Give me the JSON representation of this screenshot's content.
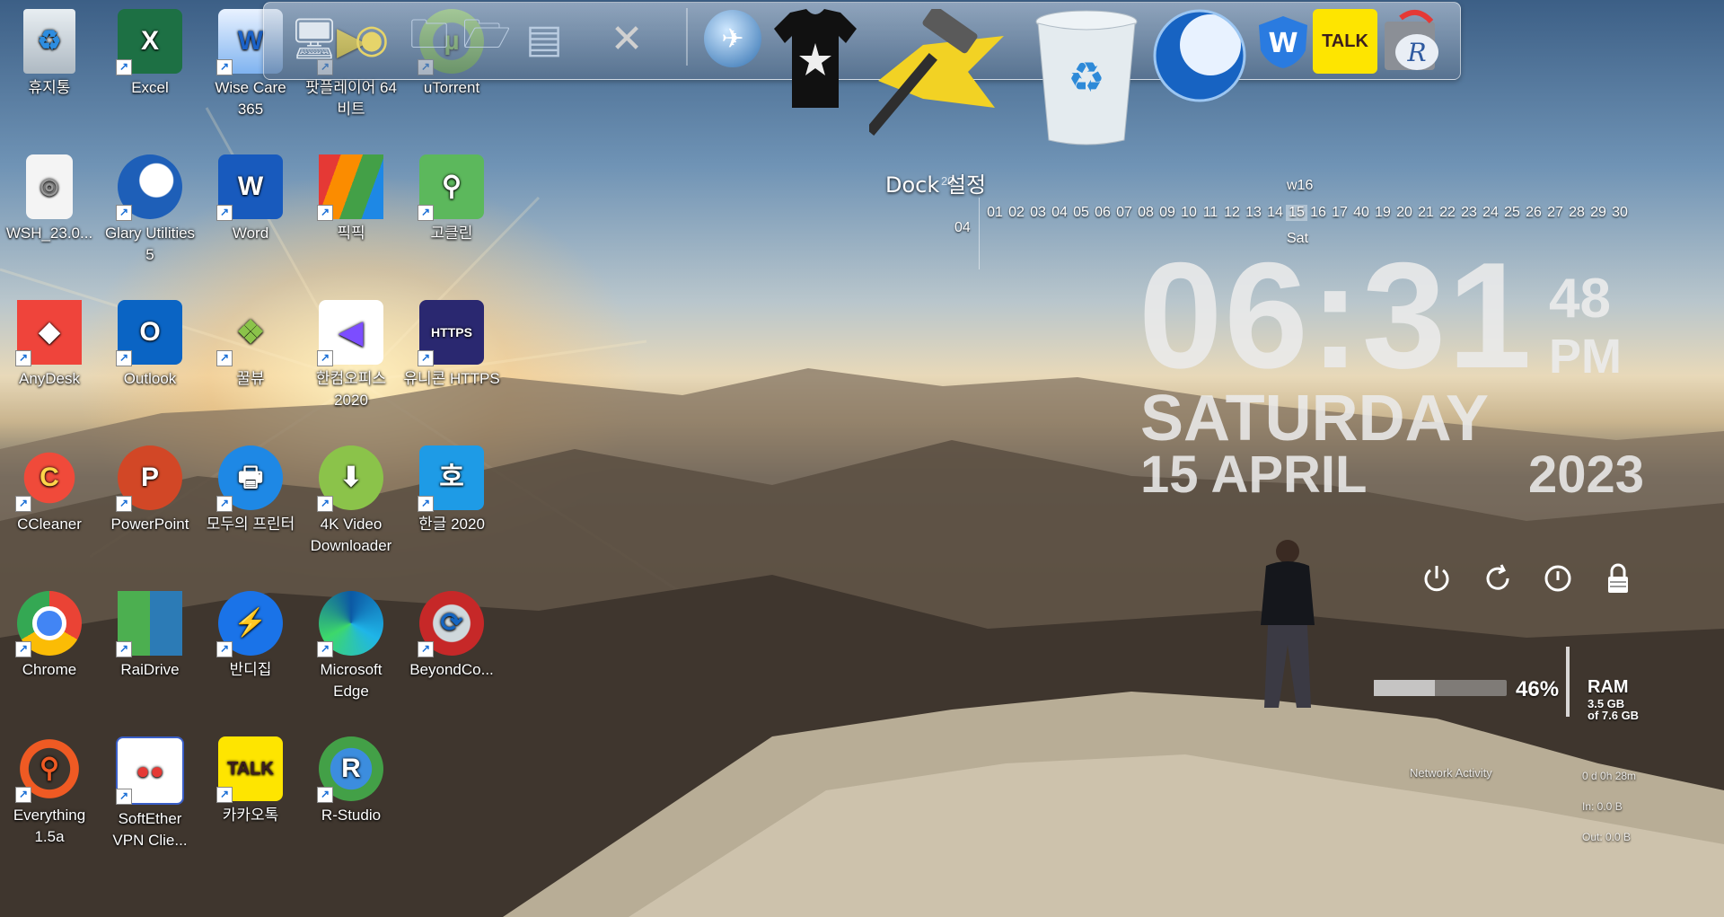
{
  "desktop_icons": [
    {
      "label": "휴지통",
      "icon": "recycle-bin-icon"
    },
    {
      "label": "Excel",
      "icon": "excel-icon"
    },
    {
      "label": "Wise Care 365",
      "icon": "wise-care-icon"
    },
    {
      "label": "팟플레이어 64 비트",
      "icon": "potplayer-icon"
    },
    {
      "label": "uTorrent",
      "icon": "utorrent-icon"
    },
    {
      "label": "WSH_23.0...",
      "icon": "file-icon"
    },
    {
      "label": "Glary Utilities 5",
      "icon": "glary-icon"
    },
    {
      "label": "Word",
      "icon": "word-icon"
    },
    {
      "label": "픽픽",
      "icon": "picpick-icon"
    },
    {
      "label": "고클린",
      "icon": "goclean-icon"
    },
    {
      "label": "AnyDesk",
      "icon": "anydesk-icon"
    },
    {
      "label": "Outlook",
      "icon": "outlook-icon"
    },
    {
      "label": "꿀뷰",
      "icon": "honeyview-icon"
    },
    {
      "label": "한컴오피스 2020",
      "icon": "hancom-office-icon"
    },
    {
      "label": "유니콘 HTTPS",
      "icon": "unicorn-https-icon"
    },
    {
      "label": "CCleaner",
      "icon": "ccleaner-icon"
    },
    {
      "label": "PowerPoint",
      "icon": "powerpoint-icon"
    },
    {
      "label": "모두의 프린터",
      "icon": "printer-icon"
    },
    {
      "label": "4K Video Downloader",
      "icon": "4k-downloader-icon"
    },
    {
      "label": "한글 2020",
      "icon": "hangul-icon"
    },
    {
      "label": "Chrome",
      "icon": "chrome-icon"
    },
    {
      "label": "RaiDrive",
      "icon": "raidrive-icon"
    },
    {
      "label": "반디집",
      "icon": "bandizip-icon"
    },
    {
      "label": "Microsoft Edge",
      "icon": "edge-icon"
    },
    {
      "label": "BeyondCo...",
      "icon": "beyond-compare-icon"
    },
    {
      "label": "Everything 1.5a",
      "icon": "everything-icon"
    },
    {
      "label": "SoftEther VPN Clie...",
      "icon": "softether-icon"
    },
    {
      "label": "카카오톡",
      "icon": "kakaotalk-icon"
    },
    {
      "label": "R-Studio",
      "icon": "rstudio-icon"
    }
  ],
  "dock": {
    "settings_label": "Dock 설정",
    "items": [
      "computer-icon",
      "mycomputer-icon",
      "folder-icon",
      "folder-open-icon",
      "control-panel-icon",
      "tools-icon",
      "globe-icon",
      "tshirt-icon",
      "hammer-icon",
      "trash-icon",
      "glary-icon",
      "wise-icon",
      "kakaotalk-icon",
      "rstudio-icon"
    ],
    "kakao_label": "TALK"
  },
  "calendar": {
    "week": "w16",
    "year_short": "20",
    "month": "04",
    "days": [
      "01",
      "02",
      "03",
      "04",
      "05",
      "06",
      "07",
      "08",
      "09",
      "10",
      "11",
      "12",
      "13",
      "14",
      "15",
      "16",
      "17",
      "40",
      "19",
      "20",
      "21",
      "22",
      "23",
      "24",
      "25",
      "26",
      "27",
      "28",
      "29",
      "30"
    ],
    "today": "15",
    "dayname": "Sat"
  },
  "clock": {
    "time": "06:31",
    "seconds": "48",
    "ampm": "PM",
    "day": "SATURDAY",
    "date": "15 APRIL",
    "year": "2023"
  },
  "system": {
    "ram_percent": "46%",
    "ram_fraction": 0.46,
    "ram_label": "RAM",
    "ram_used": "3.5 GB",
    "ram_total": "of 7.6 GB",
    "network_title": "Network Activity",
    "uptime": "0 d 0h 28m",
    "net_in": "In: 0.0 B",
    "net_out": "Out: 0.0 B"
  }
}
